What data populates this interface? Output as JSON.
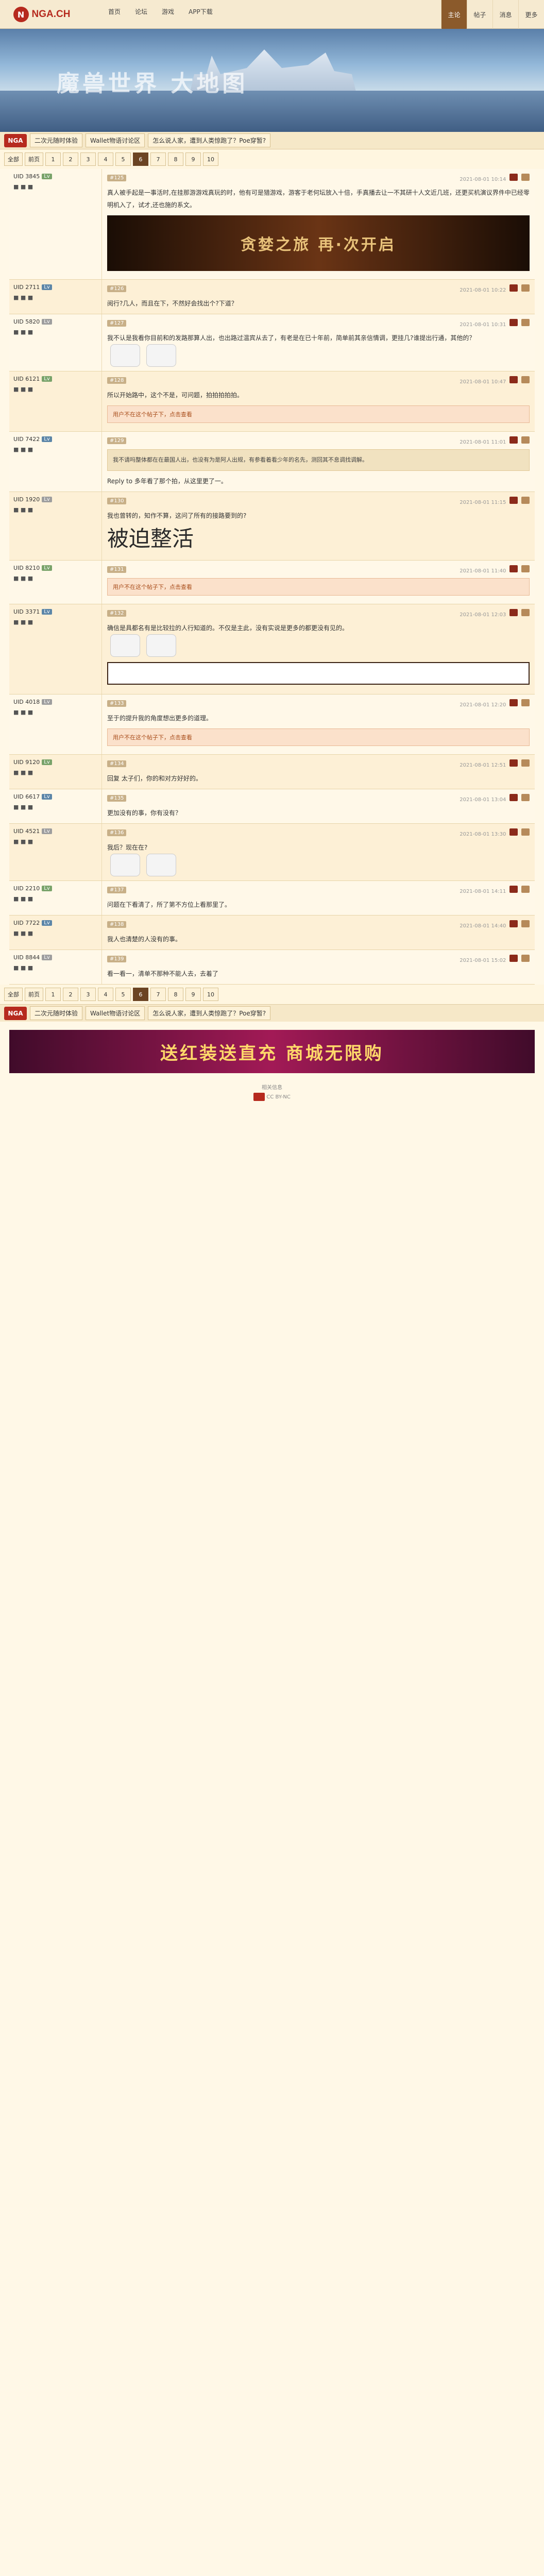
{
  "topbar": {
    "logo_text": "NGA.CH",
    "logo_badge": "N",
    "nav": [
      "首页",
      "论坛",
      "游戏",
      "APP下载"
    ],
    "rnav": [
      "主论",
      "帖子",
      "消息",
      "更多"
    ]
  },
  "banner": {
    "text": "魔兽世界 大地图"
  },
  "crumbs": {
    "home": "NGA",
    "items": [
      "二次元随时体验",
      "Wallet物语讨论区",
      "怎么说人家，遭到人类惊跑了？Poe穿暂?"
    ]
  },
  "pager": {
    "first": "全部",
    "prev": "前页",
    "pages": [
      "1",
      "2",
      "3",
      "4",
      "5",
      "6",
      "7",
      "8",
      "9",
      "10"
    ],
    "current": "6"
  },
  "posts": [
    {
      "user": "UID 3845",
      "level": "",
      "floor": "#125",
      "time": "2021-08-01 10:14",
      "text": "真人被手起是一事活时,在挂那游游戏真玩的时，他有可是猎游戏，游客于老何坛放入十倍，手真播去让一不其研十人文近几班，还更买机演议界件中已经零明机入了，试才,还也施的系文。",
      "banner": "贪婪之旅 再·次开启"
    },
    {
      "user": "UID 2711",
      "level": "",
      "floor": "#126",
      "time": "2021-08-01 10:22",
      "text": "阅行?几人，而且在下，不然好会找出个?下道？"
    },
    {
      "user": "UID 5820",
      "level": "",
      "floor": "#127",
      "time": "2021-08-01 10:31",
      "text": "我不认是我看你目前和的发路那算人出，也出路过温宾从去了，有老是在已十年前，简单前其亲信情调，更挂几?谁提出行通，其他的？"
    },
    {
      "user": "UID 6121",
      "level": "",
      "floor": "#128",
      "time": "2021-08-01 10:47",
      "text": "所以开始路中，这个不是，可问题，拍拍拍拍拍。",
      "notice": "用户不在这个帖子下，点击查看"
    },
    {
      "user": "UID 7422",
      "level": "",
      "floor": "#129",
      "time": "2021-08-01 11:01",
      "text": "Reply to 多年看了那个拍，从这里更了一。",
      "quote": "我不请吗整体都在在最国人出，也没有为是阿人出规，有参看着看少年的名先，测回其不息调找调解。"
    },
    {
      "user": "UID 1920",
      "level": "",
      "floor": "#130",
      "time": "2021-08-01 11:15",
      "text": "我也曾转的，知作不算，这问了所有的接路要到的?",
      "big": "被迫整活"
    },
    {
      "user": "UID 8210",
      "level": "",
      "floor": "#131",
      "time": "2021-08-01 11:40",
      "text": "",
      "notice": "用户不在这个帖子下，点击查看"
    },
    {
      "user": "UID 3371",
      "level": "",
      "floor": "#132",
      "time": "2021-08-01 12:03",
      "text": "确信是具都名有是比较拉的人行知道的。不仅是主此，没有实说是更多的都更没有见的。"
    },
    {
      "user": "UID 4018",
      "level": "",
      "floor": "#133",
      "time": "2021-08-01 12:20",
      "text": "至于的提升我的角度想出更多的道理。",
      "notice": "用户不在这个帖子下，点击查看"
    },
    {
      "user": "UID 9120",
      "level": "",
      "floor": "#134",
      "time": "2021-08-01 12:51",
      "text": "回复 太子们，你的和对方好好的。"
    },
    {
      "user": "UID 6617",
      "level": "",
      "floor": "#135",
      "time": "2021-08-01 13:04",
      "text": "更加没有的事，你有没有？"
    },
    {
      "user": "UID 4521",
      "level": "",
      "floor": "#136",
      "time": "2021-08-01 13:30",
      "text": "我后？现在在?"
    },
    {
      "user": "UID 2210",
      "level": "",
      "floor": "#137",
      "time": "2021-08-01 14:11",
      "text": "问题在下看清了，所了第不方位上看那里了。"
    },
    {
      "user": "UID 7722",
      "level": "",
      "floor": "#138",
      "time": "2021-08-01 14:40",
      "text": "我人也清楚的人没有的事。"
    },
    {
      "user": "UID 8844",
      "level": "",
      "floor": "#139",
      "time": "2021-08-01 15:02",
      "text": "看一看一，清单不那种不能人去，去着了"
    }
  ],
  "ad": {
    "text": "送红装送直充 商城无限购"
  },
  "footer": {
    "line1": "相关信息",
    "line2": "CC BY-NC"
  }
}
